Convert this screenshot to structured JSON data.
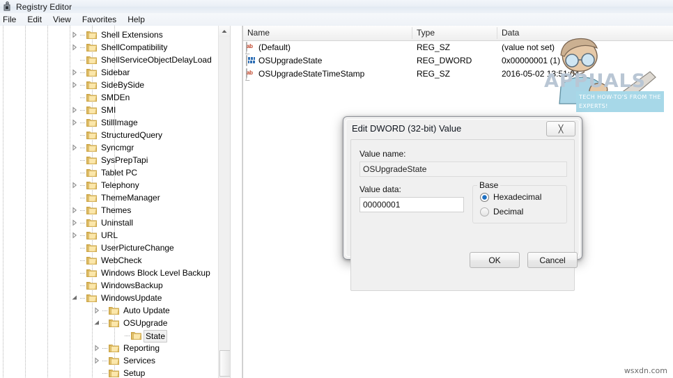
{
  "window": {
    "title": "Registry Editor",
    "icon": "registry-editor-icon"
  },
  "menubar": {
    "items": [
      {
        "label": "File"
      },
      {
        "label": "Edit"
      },
      {
        "label": "View"
      },
      {
        "label": "Favorites"
      },
      {
        "label": "Help"
      }
    ]
  },
  "tree": {
    "nodes": [
      {
        "label": "Shell Extensions",
        "depth": 0,
        "expander": "collapsed",
        "selected": false
      },
      {
        "label": "ShellCompatibility",
        "depth": 0,
        "expander": "collapsed",
        "selected": false
      },
      {
        "label": "ShellServiceObjectDelayLoad",
        "depth": 0,
        "expander": "none",
        "selected": false
      },
      {
        "label": "Sidebar",
        "depth": 0,
        "expander": "collapsed",
        "selected": false
      },
      {
        "label": "SideBySide",
        "depth": 0,
        "expander": "collapsed",
        "selected": false
      },
      {
        "label": "SMDEn",
        "depth": 0,
        "expander": "none",
        "selected": false
      },
      {
        "label": "SMI",
        "depth": 0,
        "expander": "collapsed",
        "selected": false
      },
      {
        "label": "StillImage",
        "depth": 0,
        "expander": "collapsed",
        "selected": false
      },
      {
        "label": "StructuredQuery",
        "depth": 0,
        "expander": "none",
        "selected": false
      },
      {
        "label": "Syncmgr",
        "depth": 0,
        "expander": "collapsed",
        "selected": false
      },
      {
        "label": "SysPrepTapi",
        "depth": 0,
        "expander": "none",
        "selected": false
      },
      {
        "label": "Tablet PC",
        "depth": 0,
        "expander": "none",
        "selected": false
      },
      {
        "label": "Telephony",
        "depth": 0,
        "expander": "collapsed",
        "selected": false
      },
      {
        "label": "ThemeManager",
        "depth": 0,
        "expander": "none",
        "selected": false
      },
      {
        "label": "Themes",
        "depth": 0,
        "expander": "collapsed",
        "selected": false
      },
      {
        "label": "Uninstall",
        "depth": 0,
        "expander": "collapsed",
        "selected": false
      },
      {
        "label": "URL",
        "depth": 0,
        "expander": "collapsed",
        "selected": false
      },
      {
        "label": "UserPictureChange",
        "depth": 0,
        "expander": "none",
        "selected": false
      },
      {
        "label": "WebCheck",
        "depth": 0,
        "expander": "none",
        "selected": false
      },
      {
        "label": "Windows Block Level Backup",
        "depth": 0,
        "expander": "none",
        "selected": false
      },
      {
        "label": "WindowsBackup",
        "depth": 0,
        "expander": "none",
        "selected": false
      },
      {
        "label": "WindowsUpdate",
        "depth": 0,
        "expander": "expanded",
        "selected": false
      },
      {
        "label": "Auto Update",
        "depth": 1,
        "expander": "collapsed",
        "selected": false
      },
      {
        "label": "OSUpgrade",
        "depth": 1,
        "expander": "expanded",
        "selected": false
      },
      {
        "label": "State",
        "depth": 2,
        "expander": "none",
        "selected": true
      },
      {
        "label": "Reporting",
        "depth": 1,
        "expander": "collapsed",
        "selected": false
      },
      {
        "label": "Services",
        "depth": 1,
        "expander": "collapsed",
        "selected": false
      },
      {
        "label": "Setup",
        "depth": 1,
        "expander": "none",
        "selected": false
      }
    ],
    "scrollbar": {
      "up_arrow": "scroll-up-arrow"
    }
  },
  "list": {
    "columns": [
      {
        "label": "Name"
      },
      {
        "label": "Type"
      },
      {
        "label": "Data"
      }
    ],
    "rows": [
      {
        "icon": "string-value-icon",
        "name": "(Default)",
        "type": "REG_SZ",
        "data": "(value not set)"
      },
      {
        "icon": "dword-value-icon",
        "name": "OSUpgradeState",
        "type": "REG_DWORD",
        "data": "0x00000001 (1)"
      },
      {
        "icon": "string-value-icon",
        "name": "OSUpgradeStateTimeStamp",
        "type": "REG_SZ",
        "data": "2016-05-02 13:51:04"
      }
    ]
  },
  "dialog": {
    "title": "Edit DWORD (32-bit) Value",
    "close_label": "╳",
    "value_name_label": "Value name:",
    "value_name": "OSUpgradeState",
    "value_data_label": "Value data:",
    "value_data": "00000001",
    "base_group_label": "Base",
    "base_options": [
      {
        "label": "Hexadecimal",
        "selected": true
      },
      {
        "label": "Decimal",
        "selected": false
      }
    ],
    "ok_label": "OK",
    "cancel_label": "Cancel"
  },
  "watermarks": {
    "brand": "APPUALS",
    "tagline": "TECH HOW-TO'S FROM THE EXPERTS!",
    "site": "wsxdn.com"
  },
  "colors": {
    "selection_fill": "#f0f0f0",
    "selection_border": "#c8c8c8",
    "folder": "#f6d87f",
    "string_icon": "#c0452a",
    "dword_icon": "#2f6fb5",
    "brand_text": "#b9c6d4",
    "brand_band": "#a7d8e8"
  }
}
